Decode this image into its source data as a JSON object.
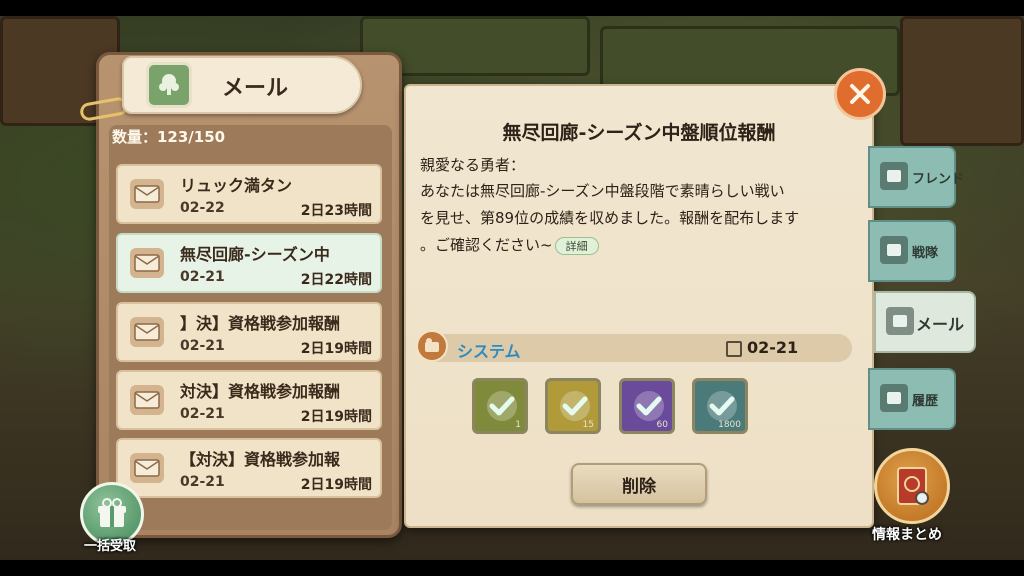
{
  "header": {
    "title": "メール",
    "count_label": "数量：123/150"
  },
  "mails": [
    {
      "title": "リュック満タン",
      "date": "02-22",
      "remain": "2日23時間",
      "selected": false
    },
    {
      "title": "無尽回廊-シーズン中",
      "date": "02-21",
      "remain": "2日22時間",
      "selected": true
    },
    {
      "title": "】決】資格戦参加報酬",
      "date": "02-21",
      "remain": "2日19時間",
      "selected": false
    },
    {
      "title": "対決】資格戦参加報酬",
      "date": "02-21",
      "remain": "2日19時間",
      "selected": false
    },
    {
      "title": "【対決】資格戦参加報",
      "date": "02-21",
      "remain": "2日19時間",
      "selected": false
    }
  ],
  "bulk_button": {
    "label": "一括受取"
  },
  "detail": {
    "title": "無尽回廊-シーズン中盤順位報酬",
    "greeting": "親愛なる勇者：",
    "body_line1": "あなたは無尽回廊-シーズン中盤段階で素晴らしい戦い",
    "body_line2": "を見せ、第89位の成績を収めました。報酬を配布します",
    "body_line3": "。ご確認ください~",
    "detail_link": "詳細",
    "sender": "システム",
    "date": "02-21",
    "rewards": [
      {
        "icon": "reward-item-1-icon",
        "qty": "1",
        "color": "#7f8a3a"
      },
      {
        "icon": "reward-item-2-icon",
        "qty": "15",
        "color": "#b09a3a"
      },
      {
        "icon": "reward-item-3-icon",
        "qty": "60",
        "color": "#6a4a9a"
      },
      {
        "icon": "reward-item-4-icon",
        "qty": "1800",
        "color": "#4a7a7a"
      }
    ],
    "delete_label": "削除"
  },
  "side_tabs": [
    {
      "label": "フレンド",
      "active": false
    },
    {
      "label": "戦隊",
      "active": false
    },
    {
      "label": "メール",
      "active": true
    },
    {
      "label": "履歴",
      "active": false
    }
  ],
  "info_button": {
    "label": "情報まとめ"
  },
  "colors": {
    "accent_close": "#e06c2e",
    "sender_blue": "#2e8bc0",
    "tab_teal": "#8dbdb2"
  }
}
